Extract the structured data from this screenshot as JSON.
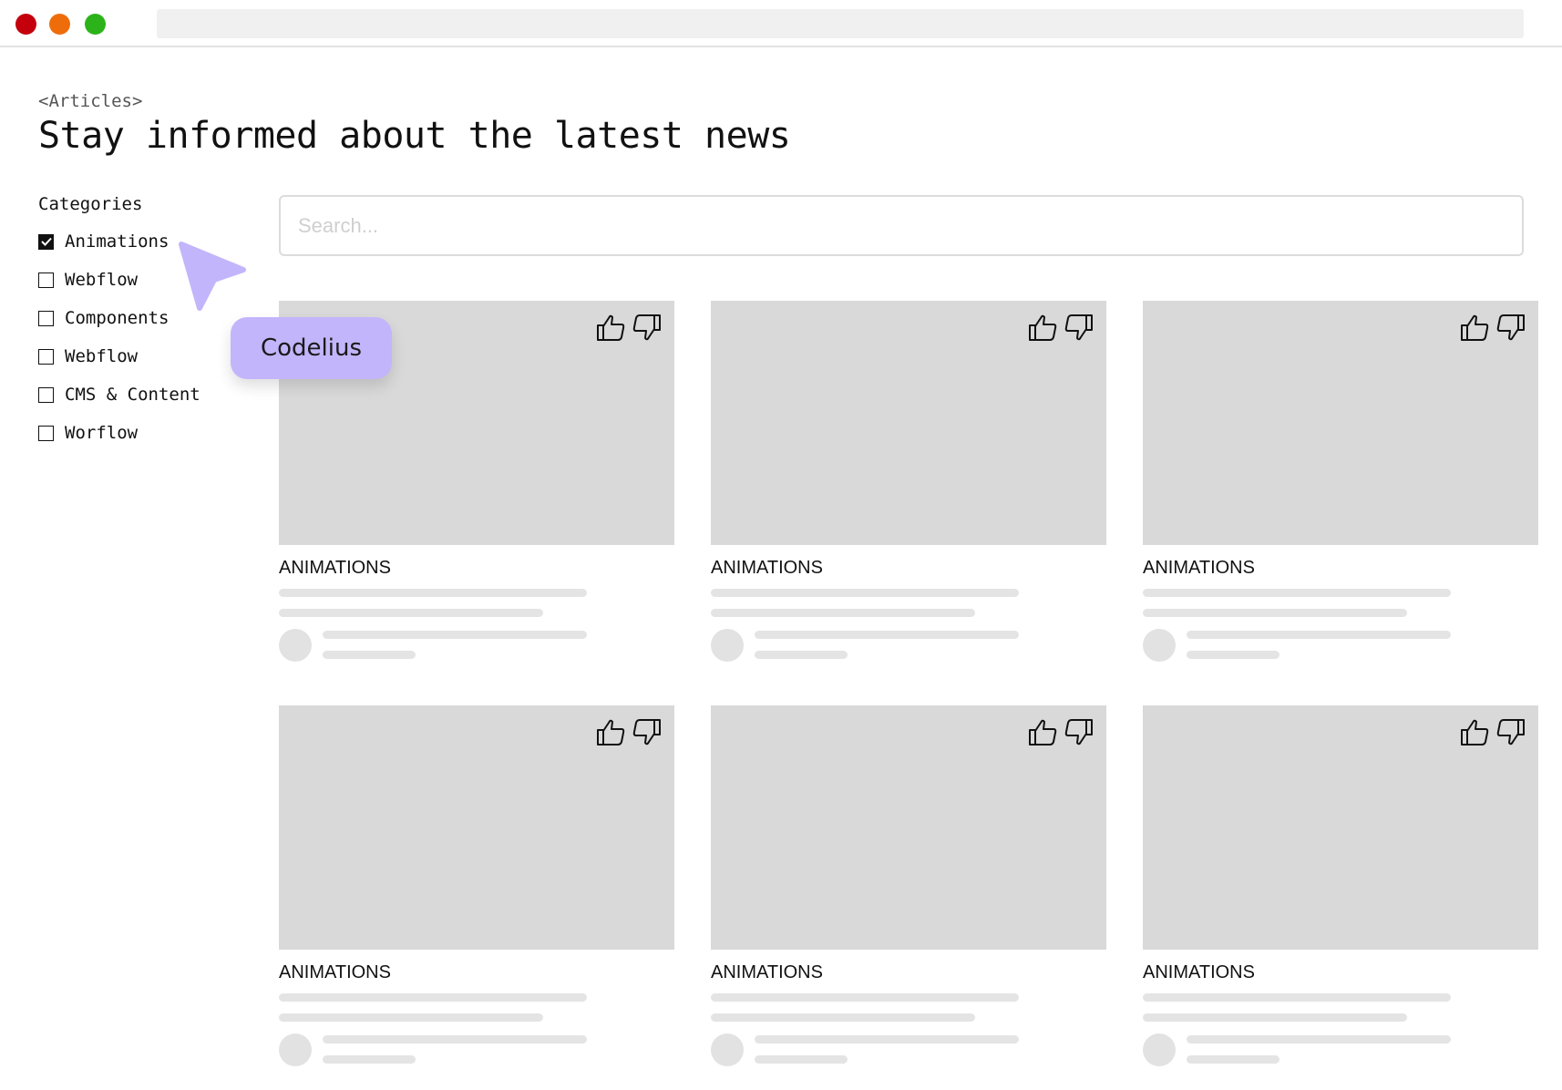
{
  "window": {
    "controls": [
      "close",
      "minimize",
      "maximize"
    ],
    "colors": {
      "close": "#c4000c",
      "minimize": "#ee6d0a",
      "maximize": "#2db31a"
    }
  },
  "header": {
    "eyebrow": "<Articles>",
    "title": "Stay informed about the latest news"
  },
  "categories": {
    "heading": "Categories",
    "items": [
      {
        "label": "Animations",
        "checked": true
      },
      {
        "label": "Webflow",
        "checked": false
      },
      {
        "label": "Components",
        "checked": false
      },
      {
        "label": "Webflow",
        "checked": false
      },
      {
        "label": "CMS & Content",
        "checked": false
      },
      {
        "label": "Worflow",
        "checked": false
      }
    ]
  },
  "search": {
    "placeholder": "Search...",
    "value": ""
  },
  "cards": [
    {
      "category": "ANIMATIONS",
      "icons": [
        "thumbs-up-icon",
        "thumbs-down-icon"
      ]
    },
    {
      "category": "ANIMATIONS",
      "icons": [
        "thumbs-up-icon",
        "thumbs-down-icon"
      ]
    },
    {
      "category": "ANIMATIONS",
      "icons": [
        "thumbs-up-icon",
        "thumbs-down-icon"
      ]
    },
    {
      "category": "ANIMATIONS",
      "icons": [
        "thumbs-up-icon",
        "thumbs-down-icon"
      ]
    },
    {
      "category": "ANIMATIONS",
      "icons": [
        "thumbs-up-icon",
        "thumbs-down-icon"
      ]
    },
    {
      "category": "ANIMATIONS",
      "icons": [
        "thumbs-up-icon",
        "thumbs-down-icon"
      ]
    }
  ],
  "cursor_tag": {
    "label": "Codelius",
    "color": "#c3b5fb"
  }
}
